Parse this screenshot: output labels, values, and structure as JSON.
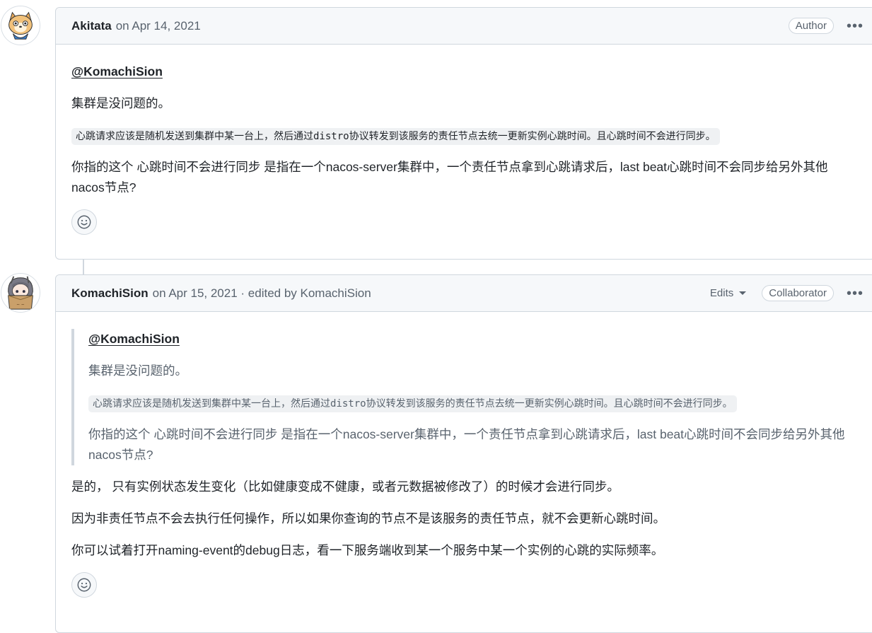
{
  "comments": [
    {
      "author": "Akitata",
      "date_text": "on Apr 14, 2021",
      "badge": "Author",
      "mention": "@KomachiSion",
      "para1": "集群是没问题的。",
      "code": "心跳请求应该是随机发送到集群中某一台上，然后通过distro协议转发到该服务的责任节点去统一更新实例心跳时间。且心跳时间不会进行同步。",
      "para2": "你指的这个 心跳时间不会进行同步 是指在一个nacos-server集群中，一个责任节点拿到心跳请求后，last beat心跳时间不会同步给另外其他nacos节点?"
    },
    {
      "author": "KomachiSion",
      "date_text": "on Apr 15, 2021 · edited by KomachiSion",
      "edits_label": "Edits",
      "badge": "Collaborator",
      "quote": {
        "mention": "@KomachiSion",
        "para1": "集群是没问题的。",
        "code": "心跳请求应该是随机发送到集群中某一台上，然后通过distro协议转发到该服务的责任节点去统一更新实例心跳时间。且心跳时间不会进行同步。",
        "para2": "你指的这个 心跳时间不会进行同步 是指在一个nacos-server集群中，一个责任节点拿到心跳请求后，last beat心跳时间不会同步给另外其他nacos节点?"
      },
      "para1": "是的， 只有实例状态发生变化（比如健康变成不健康，或者元数据被修改了）的时候才会进行同步。",
      "para2": "因为非责任节点不会去执行任何操作，所以如果你查询的节点不是该服务的责任节点，就不会更新心跳时间。",
      "para3": "你可以试着打开naming-event的debug日志，看一下服务端收到某一个服务中某一个实例的心跳的实际频率。"
    }
  ],
  "icons": {
    "kebab": "kebab-horizontal-icon",
    "reaction": "smiley-icon",
    "caret": "triangle-down-icon"
  },
  "colors": {
    "border": "#d0d7de",
    "header_bg": "#f6f8fa",
    "muted": "#59636e",
    "text": "#1f2328"
  }
}
